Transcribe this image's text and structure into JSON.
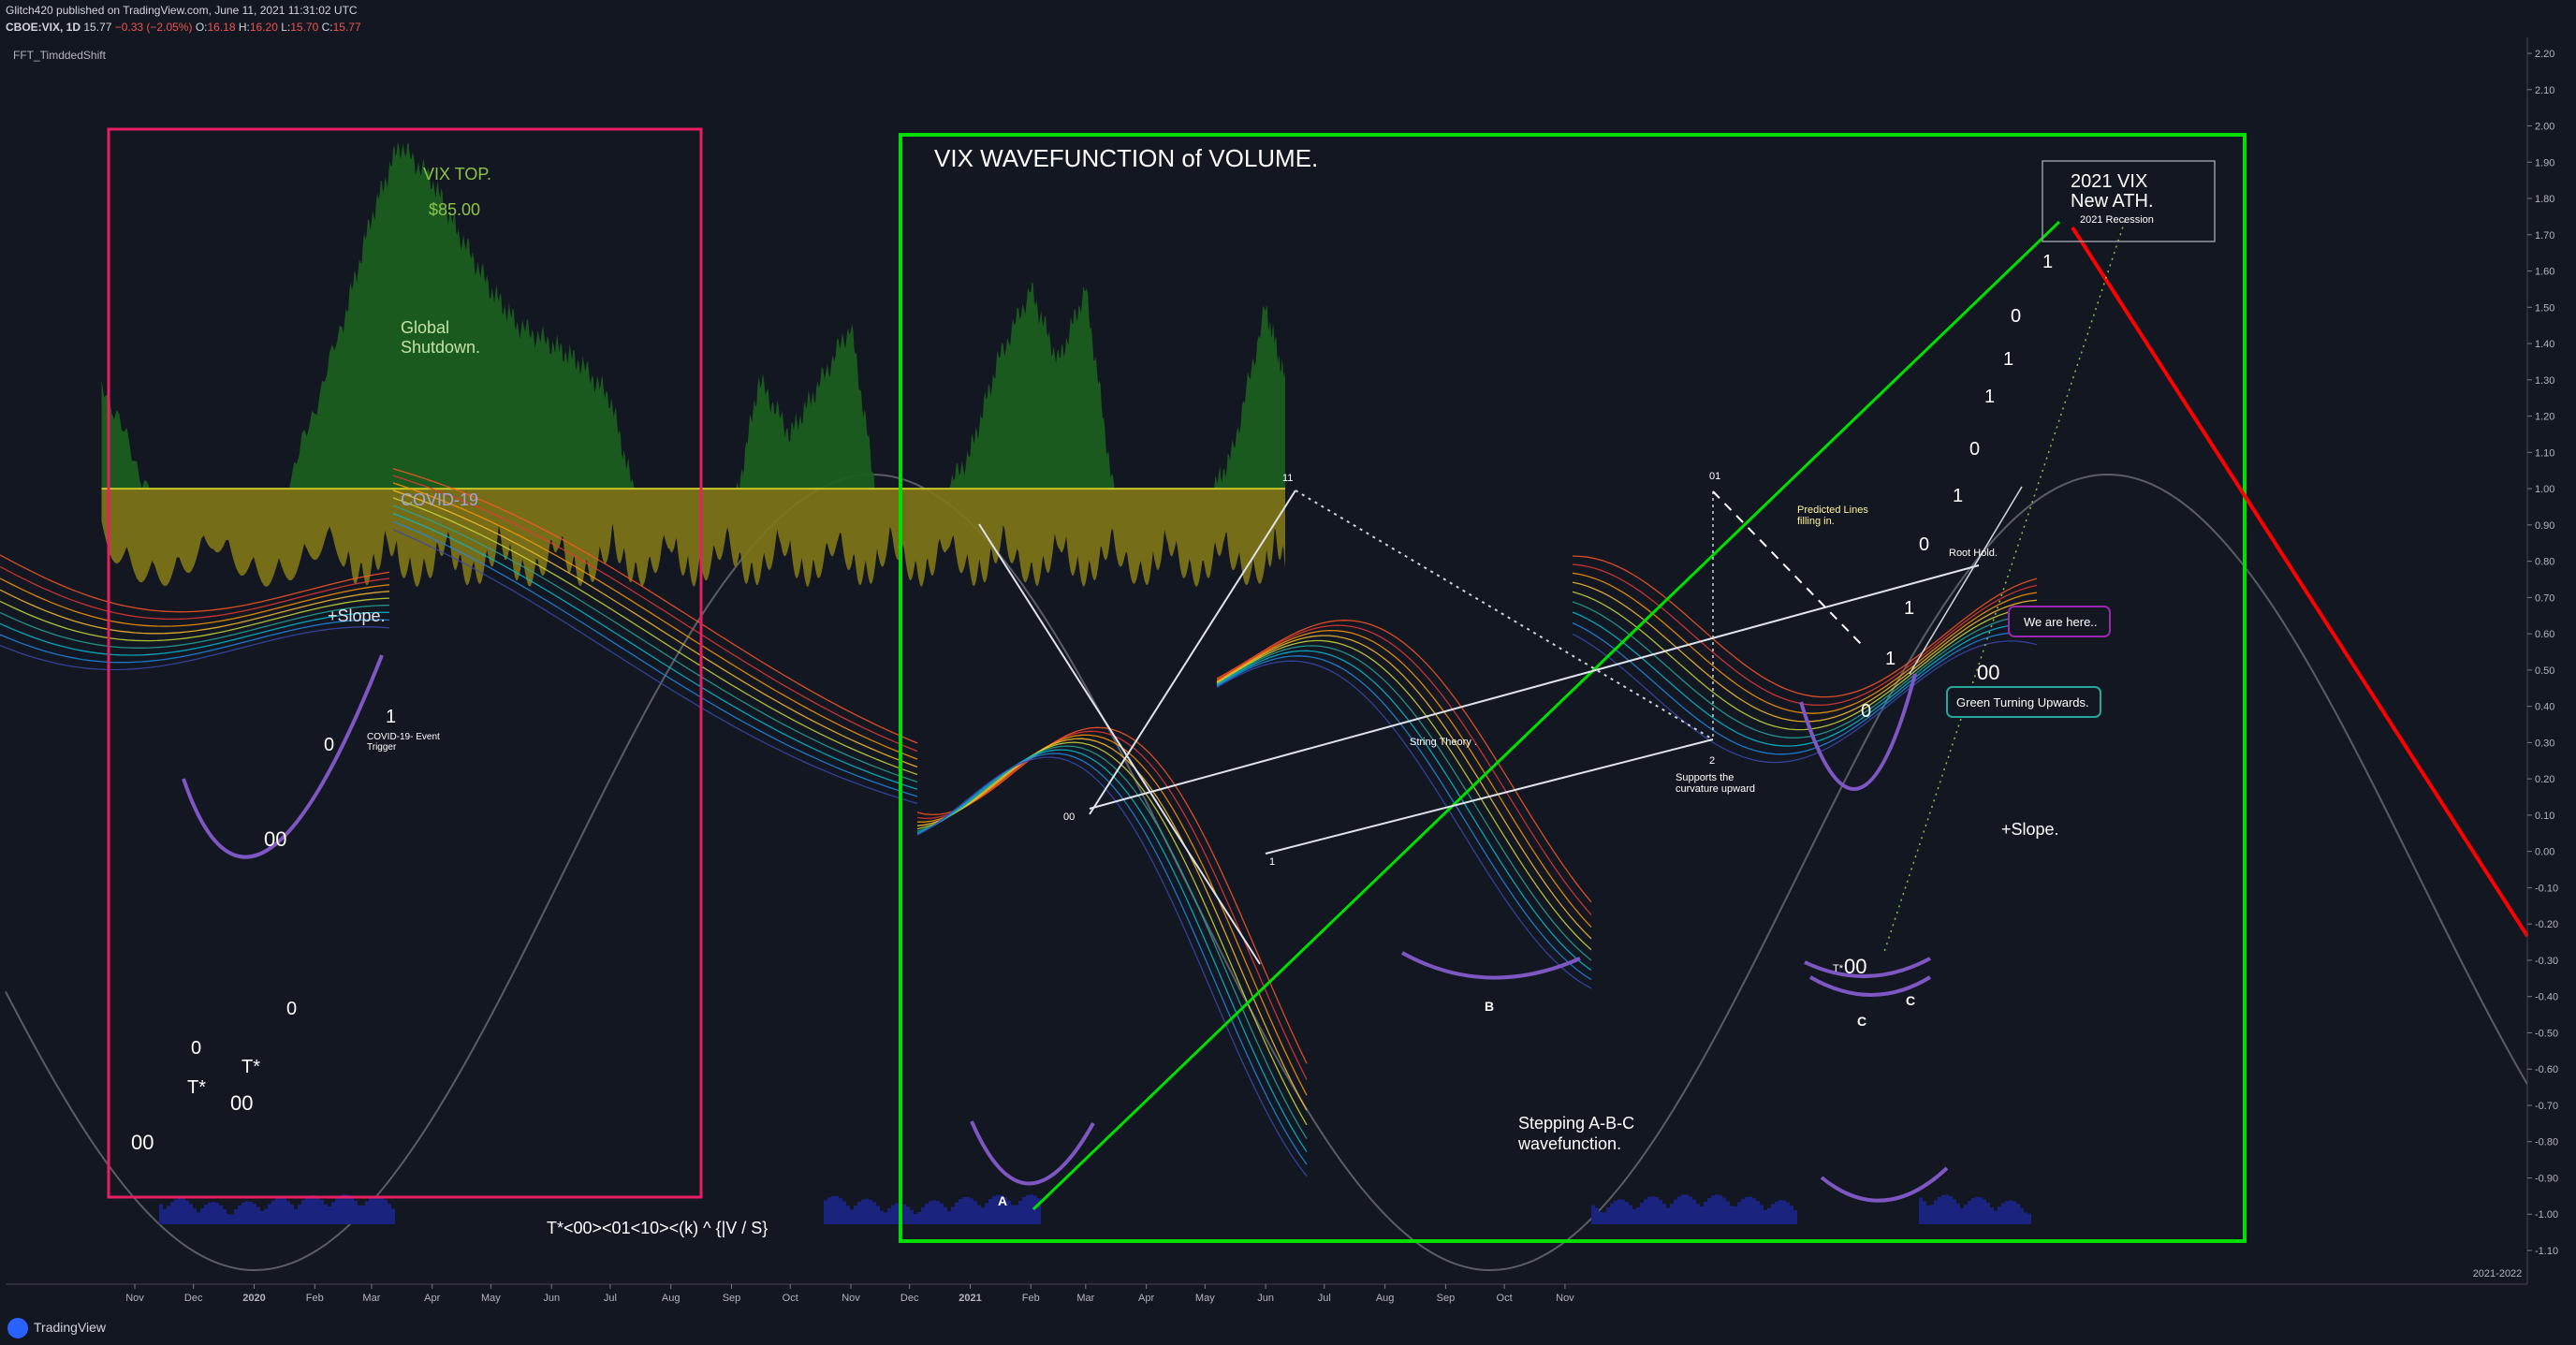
{
  "header": {
    "publisher_line": "Glitch420 published on TradingView.com, June 11, 2021 11:31:02 UTC",
    "symbol": "CBOE:VIX, 1D",
    "last": "15.77",
    "change": "−0.33 (−2.05%)",
    "o_label": "O:",
    "o_value": "16.18",
    "h_label": "H:",
    "h_value": "16.20",
    "l_label": "L:",
    "l_value": "15.70",
    "c_label": "C:",
    "c_value": "15.77"
  },
  "indicator_name": "FFT_TimddedShift",
  "footer": {
    "brand": "TradingView",
    "period_label": "2021-2022"
  },
  "colors": {
    "background": "#131722",
    "green_area": "#1b5e20",
    "yellow_area": "#827717",
    "box_red": "#e91e63",
    "box_green": "#00e000",
    "trend_red": "#ff0000",
    "purple_arc": "#7e57c2",
    "volume": "#1a237e",
    "cycle_gray": "#5a5d66"
  },
  "annotations": {
    "vix_top": "VIX TOP.",
    "price_85": "$85.00",
    "global_shutdown_1": "Global",
    "global_shutdown_2": "Shutdown.",
    "covid19": "COVID-19",
    "slope_left": "+Slope.",
    "covid_event_1": "COVID-19- Event",
    "covid_event_2": "Trigger",
    "wavefunction_title": "VIX WAVEFUNCTION of VOLUME.",
    "ath_1": "2021 VIX",
    "ath_2": "New ATH.",
    "recession": "2021 Recession",
    "predicted_1": "Predicted  Lines",
    "predicted_2": "filling in.",
    "root_hold": "Root Hold.",
    "we_are_here": "We are here..",
    "green_turning": "Green Turning Upwards.",
    "string_theory": "String Theory .",
    "supports_1": "Supports the",
    "supports_2": "curvature upward",
    "slope_right": "+Slope.",
    "stepping_1": "Stepping A-B-C",
    "stepping_2": "wavefunction.",
    "formula": "T*<00><01<10><(k) ^ {|V / S}",
    "label_A": "A",
    "label_B": "B",
    "label_C1": "C",
    "label_C2": "C",
    "lbl_11": "11",
    "lbl_01": "01",
    "lbl_00_a": "00",
    "lbl_1_a": "1",
    "lbl_2": "2",
    "tstar": "T*"
  },
  "chart_data": {
    "type": "area",
    "title": "",
    "x_ticks": [
      "Nov",
      "Dec",
      "2020",
      "Feb",
      "Mar",
      "Apr",
      "May",
      "Jun",
      "Jul",
      "Aug",
      "Sep",
      "Oct",
      "Nov",
      "Dec",
      "2021",
      "Feb",
      "Mar",
      "Apr",
      "May",
      "Jun",
      "Jul",
      "Aug",
      "Sep",
      "Oct",
      "Nov"
    ],
    "y_ticks": [
      "2.20",
      "2.10",
      "2.00",
      "1.90",
      "1.80",
      "1.70",
      "1.60",
      "1.50",
      "1.40",
      "1.30",
      "1.20",
      "1.10",
      "1.00",
      "0.90",
      "0.80",
      "0.70",
      "0.60",
      "0.50",
      "0.40",
      "0.30",
      "0.20",
      "0.10",
      "0.00",
      "-0.10",
      "-0.20",
      "-0.30",
      "-0.40",
      "-0.50",
      "-0.60",
      "-0.70",
      "-0.80",
      "-0.90",
      "-1.00",
      "-1.10"
    ],
    "ylim": [
      -1.1,
      2.2
    ],
    "grid": false,
    "series": [
      {
        "name": "FFT_TimddedShift",
        "x": [
          "2019-10-15",
          "2019-11-15",
          "2019-12-15",
          "2020-01-15",
          "2020-02-15",
          "2020-03-01",
          "2020-03-15",
          "2020-04-01",
          "2020-04-15",
          "2020-05-01",
          "2020-05-15",
          "2020-06-01",
          "2020-06-15",
          "2020-07-01",
          "2020-07-15",
          "2020-08-01",
          "2020-08-15",
          "2020-09-01",
          "2020-09-15",
          "2020-10-01",
          "2020-10-15",
          "2020-11-01",
          "2020-11-15",
          "2020-12-01",
          "2020-12-15",
          "2021-01-01",
          "2021-01-15",
          "2021-02-01",
          "2021-02-15",
          "2021-03-01",
          "2021-03-15",
          "2021-04-01",
          "2021-04-15",
          "2021-05-01",
          "2021-05-15",
          "2021-06-01",
          "2021-06-11"
        ],
        "values": [
          1.3,
          0.9,
          0.88,
          0.95,
          1.45,
          1.75,
          1.95,
          1.85,
          1.7,
          1.55,
          1.45,
          1.4,
          1.35,
          1.25,
          0.95,
          0.78,
          0.68,
          0.9,
          1.3,
          1.15,
          1.28,
          1.45,
          0.95,
          0.85,
          0.95,
          1.1,
          1.35,
          1.55,
          1.35,
          1.55,
          1.0,
          0.85,
          0.75,
          0.95,
          1.1,
          1.5,
          1.3
        ]
      }
    ],
    "baseline": 1.0
  }
}
